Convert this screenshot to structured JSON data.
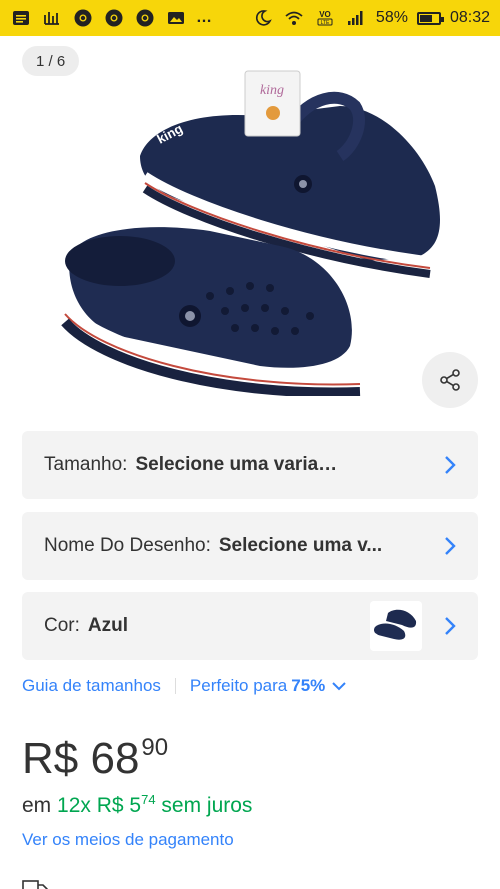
{
  "status_bar": {
    "dots": "…",
    "battery_text": "58%",
    "battery_level": 0.58,
    "time": "08:32",
    "icons": [
      "message-icon",
      "equalizer-icon",
      "chrome-icon",
      "chrome-icon",
      "chrome-icon",
      "photo-icon",
      "moon-alarm-icon",
      "wifi-icon",
      "volte-icon",
      "signal-icon",
      "battery-icon"
    ]
  },
  "gallery": {
    "counter": "1 / 6"
  },
  "variations": {
    "size": {
      "label": "Tamanho:",
      "value": "Selecione uma variação"
    },
    "design": {
      "label": "Nome Do Desenho:",
      "value": "Selecione uma v..."
    },
    "color": {
      "label": "Cor:",
      "value": "Azul"
    }
  },
  "links": {
    "size_guide": "Guia de tamanhos",
    "fit_prefix": "Perfeito para",
    "fit_value": "75%"
  },
  "price": {
    "currency_amount": "R$ 68",
    "cents": "90"
  },
  "installments": {
    "prefix": "em",
    "count_price": "12x R$ 5",
    "cents": "74",
    "suffix": "sem juros"
  },
  "payment_link": "Ver os meios de pagamento",
  "colors": {
    "status_bar": "#f7d60a",
    "link": "#3483fa",
    "green": "#00a650"
  }
}
